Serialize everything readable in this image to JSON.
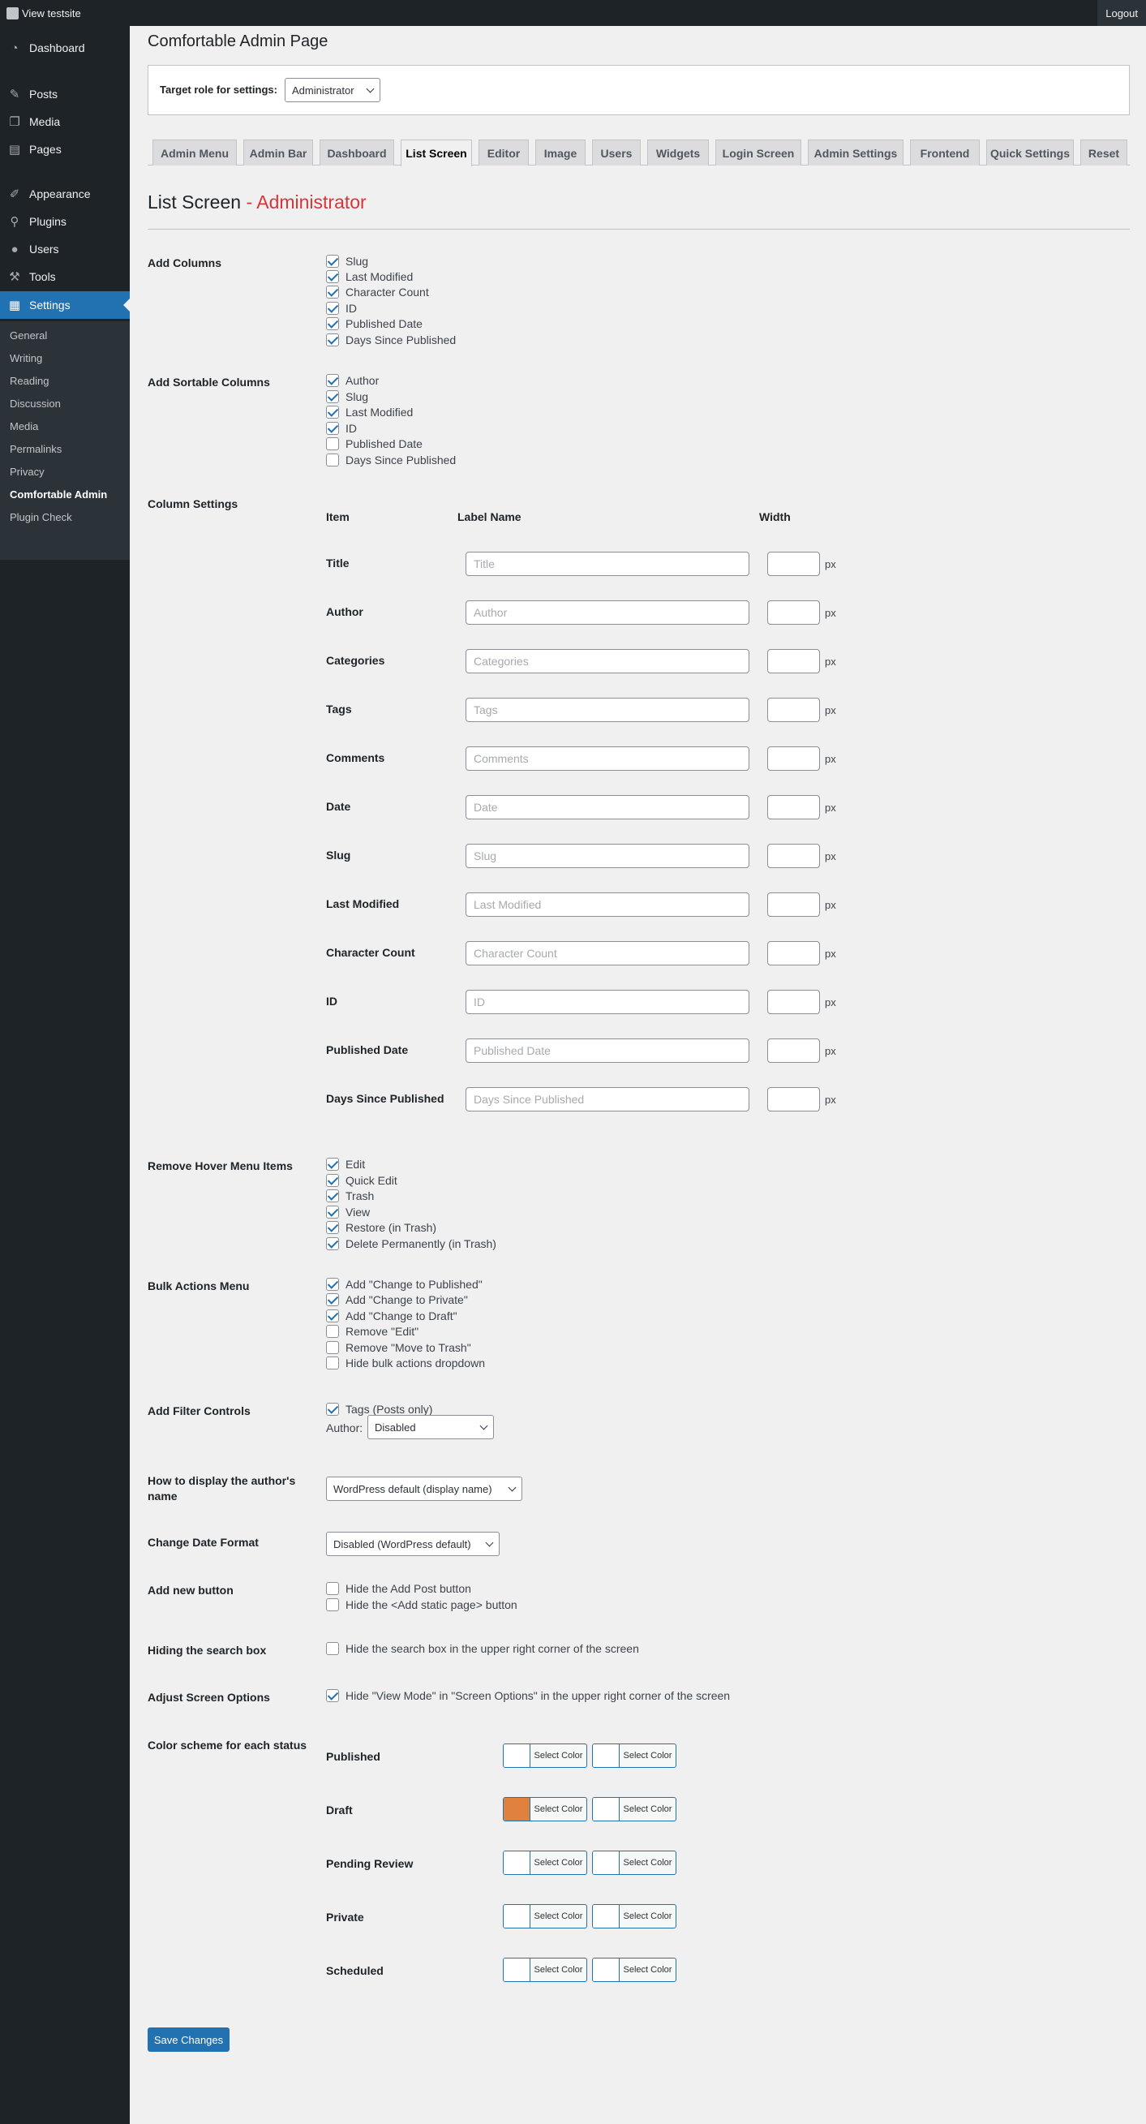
{
  "adminbar": {
    "site": "View testsite",
    "logout": "Logout"
  },
  "sidebar": {
    "items": [
      {
        "label": "Dashboard",
        "icon": "dashboard-icon",
        "glyph": "◔"
      },
      {
        "label": "Posts",
        "icon": "pin-icon",
        "glyph": "✎"
      },
      {
        "label": "Media",
        "icon": "media-icon",
        "glyph": "❐"
      },
      {
        "label": "Pages",
        "icon": "pages-icon",
        "glyph": "▤"
      },
      {
        "label": "Appearance",
        "icon": "brush-icon",
        "glyph": "✐"
      },
      {
        "label": "Plugins",
        "icon": "plug-icon",
        "glyph": "⚲"
      },
      {
        "label": "Users",
        "icon": "user-icon",
        "glyph": "●"
      },
      {
        "label": "Tools",
        "icon": "wrench-icon",
        "glyph": "⚒"
      },
      {
        "label": "Settings",
        "icon": "settings-icon",
        "glyph": "▦"
      }
    ],
    "submenu": [
      "General",
      "Writing",
      "Reading",
      "Discussion",
      "Media",
      "Permalinks",
      "Privacy",
      "Comfortable Admin",
      "Plugin Check"
    ]
  },
  "page": {
    "title": "Comfortable Admin Page",
    "role_label": "Target role for settings:",
    "role_value": "Administrator",
    "tabs": [
      "Admin Menu",
      "Admin Bar",
      "Dashboard",
      "List Screen",
      "Editor",
      "Image",
      "Users",
      "Widgets",
      "Login Screen",
      "Admin Settings",
      "Frontend",
      "Quick Settings",
      "Reset"
    ],
    "section_title": "List Screen",
    "section_role": " - Administrator"
  },
  "add_columns": {
    "label": "Add Columns",
    "options": [
      {
        "label": "Slug",
        "checked": true
      },
      {
        "label": "Last Modified",
        "checked": true
      },
      {
        "label": "Character Count",
        "checked": true
      },
      {
        "label": "ID",
        "checked": true
      },
      {
        "label": "Published Date",
        "checked": true
      },
      {
        "label": "Days Since Published",
        "checked": true
      }
    ]
  },
  "sortable_columns": {
    "label": "Add Sortable Columns",
    "options": [
      {
        "label": "Author",
        "checked": true
      },
      {
        "label": "Slug",
        "checked": true
      },
      {
        "label": "Last Modified",
        "checked": true
      },
      {
        "label": "ID",
        "checked": true
      },
      {
        "label": "Published Date",
        "checked": false
      },
      {
        "label": "Days Since Published",
        "checked": false
      }
    ]
  },
  "column_settings": {
    "label": "Column Settings",
    "head_item": "Item",
    "head_label": "Label Name",
    "head_width": "Width",
    "unit": "px",
    "rows": [
      {
        "item": "Title",
        "placeholder": "Title"
      },
      {
        "item": "Author",
        "placeholder": "Author"
      },
      {
        "item": "Categories",
        "placeholder": "Categories"
      },
      {
        "item": "Tags",
        "placeholder": "Tags"
      },
      {
        "item": "Comments",
        "placeholder": "Comments"
      },
      {
        "item": "Date",
        "placeholder": "Date"
      },
      {
        "item": "Slug",
        "placeholder": "Slug"
      },
      {
        "item": "Last Modified",
        "placeholder": "Last Modified"
      },
      {
        "item": "Character Count",
        "placeholder": "Character Count"
      },
      {
        "item": "ID",
        "placeholder": "ID"
      },
      {
        "item": "Published Date",
        "placeholder": "Published Date"
      },
      {
        "item": "Days Since Published",
        "placeholder": "Days Since Published"
      }
    ]
  },
  "hover_menu": {
    "label": "Remove Hover Menu Items",
    "options": [
      {
        "label": "Edit",
        "checked": true
      },
      {
        "label": "Quick Edit",
        "checked": true
      },
      {
        "label": "Trash",
        "checked": true
      },
      {
        "label": "View",
        "checked": true
      },
      {
        "label": "Restore (in Trash)",
        "checked": true
      },
      {
        "label": "Delete Permanently (in Trash)",
        "checked": true
      }
    ]
  },
  "bulk_actions": {
    "label": "Bulk Actions Menu",
    "options": [
      {
        "label": "Add \"Change to Published\"",
        "checked": true
      },
      {
        "label": "Add \"Change to Private\"",
        "checked": true
      },
      {
        "label": "Add \"Change to Draft\"",
        "checked": true
      },
      {
        "label": "Remove \"Edit\"",
        "checked": false
      },
      {
        "label": "Remove \"Move to Trash\"",
        "checked": false
      },
      {
        "label": "Hide bulk actions dropdown",
        "checked": false
      }
    ]
  },
  "filter_controls": {
    "label": "Add Filter Controls",
    "tags_label": "Tags (Posts only)",
    "tags_checked": true,
    "author_label": "Author:",
    "author_value": "Disabled"
  },
  "author_display": {
    "label": "How to display the author's name",
    "value": "WordPress default (display name)"
  },
  "date_format": {
    "label": "Change Date Format",
    "value": "Disabled (WordPress default)"
  },
  "add_new": {
    "label": "Add new button",
    "options": [
      {
        "label": "Hide the Add Post button",
        "checked": false
      },
      {
        "label": "Hide the <Add static page> button",
        "checked": false
      }
    ]
  },
  "search_box": {
    "label": "Hiding the search box",
    "option": "Hide the search box in the upper right corner of the screen",
    "checked": false
  },
  "screen_options": {
    "label": "Adjust Screen Options",
    "option": "Hide \"View Mode\" in \"Screen Options\" in the upper right corner of the screen",
    "checked": true
  },
  "color_scheme": {
    "label": "Color scheme for each status",
    "button_label": "Select Color",
    "statuses": [
      {
        "name": "Published",
        "color1": "#ffffff",
        "color2": "#ffffff"
      },
      {
        "name": "Draft",
        "color1": "#e0823d",
        "color2": "#ffffff"
      },
      {
        "name": "Pending Review",
        "color1": "#ffffff",
        "color2": "#ffffff"
      },
      {
        "name": "Private",
        "color1": "#ffffff",
        "color2": "#ffffff"
      },
      {
        "name": "Scheduled",
        "color1": "#ffffff",
        "color2": "#ffffff"
      }
    ]
  },
  "save_label": "Save Changes"
}
